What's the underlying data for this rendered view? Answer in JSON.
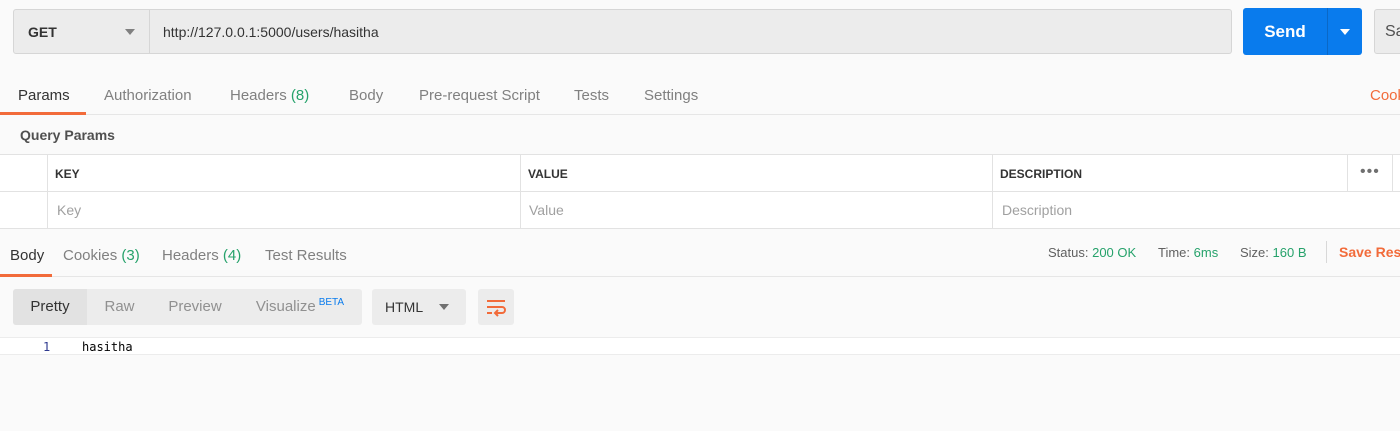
{
  "request": {
    "method": "GET",
    "url": "http://127.0.0.1:5000/users/hasitha",
    "send_label": "Send",
    "save_label": "Sa"
  },
  "request_tabs": [
    {
      "label": "Params",
      "count": "",
      "active": true
    },
    {
      "label": "Authorization",
      "count": ""
    },
    {
      "label": "Headers",
      "count": "(8)"
    },
    {
      "label": "Body",
      "count": ""
    },
    {
      "label": "Pre-request Script",
      "count": ""
    },
    {
      "label": "Tests",
      "count": ""
    },
    {
      "label": "Settings",
      "count": ""
    }
  ],
  "cookies_link": "Cook",
  "query_params": {
    "title": "Query Params",
    "columns": [
      "KEY",
      "VALUE",
      "DESCRIPTION"
    ],
    "placeholders": [
      "Key",
      "Value",
      "Description"
    ],
    "more_icon": "•••"
  },
  "response_tabs": [
    {
      "label": "Body",
      "count": "",
      "active": true
    },
    {
      "label": "Cookies",
      "count": "(3)"
    },
    {
      "label": "Headers",
      "count": "(4)"
    },
    {
      "label": "Test Results",
      "count": ""
    }
  ],
  "response_meta": {
    "status_label": "Status:",
    "status_value": "200 OK",
    "time_label": "Time:",
    "time_value": "6ms",
    "size_label": "Size:",
    "size_value": "160 B",
    "save_response": "Save Res"
  },
  "body_view": {
    "modes": [
      "Pretty",
      "Raw",
      "Preview",
      "Visualize"
    ],
    "beta": "BETA",
    "format": "HTML",
    "wrap_icon": "wrap-lines-icon"
  },
  "code": [
    {
      "line": "1",
      "text": "hasitha"
    }
  ],
  "colors": {
    "accent": "#f26b3a",
    "send": "#097bed",
    "success": "#26a26b"
  }
}
